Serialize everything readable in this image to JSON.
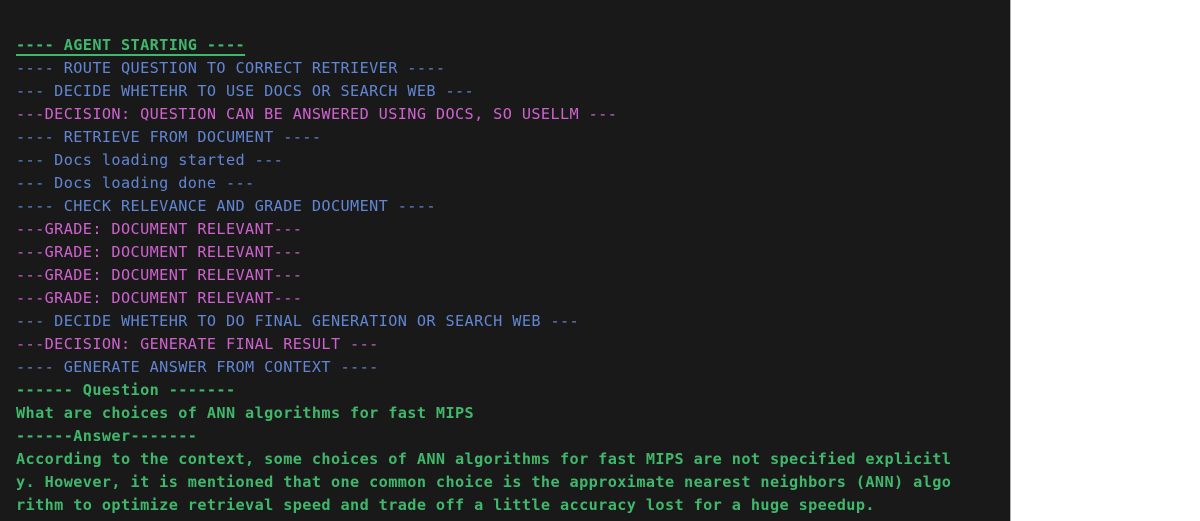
{
  "theme": {
    "terminal_background": "#191919",
    "page_background": "#ffffff",
    "divider": "#adadad",
    "green": "#3fb86b",
    "blue": "#6186d4",
    "magenta": "#d062d0"
  },
  "console": {
    "lines": [
      {
        "text": "---- AGENT STARTING ----",
        "color": "green",
        "bold": true,
        "underline": true
      },
      {
        "text": "---- ROUTE QUESTION TO CORRECT RETRIEVER ----",
        "color": "blue",
        "bold": false,
        "underline": false
      },
      {
        "text": "--- DECIDE WHETEHR TO USE DOCS OR SEARCH WEB ---",
        "color": "blue",
        "bold": false,
        "underline": false
      },
      {
        "text": "---DECISION: QUESTION CAN BE ANSWERED USING DOCS, SO USELLM ---",
        "color": "magenta",
        "bold": false,
        "underline": false
      },
      {
        "text": "---- RETRIEVE FROM DOCUMENT ----",
        "color": "blue",
        "bold": false,
        "underline": false
      },
      {
        "text": "--- Docs loading started ---",
        "color": "blue",
        "bold": false,
        "underline": false
      },
      {
        "text": "--- Docs loading done ---",
        "color": "blue",
        "bold": false,
        "underline": false
      },
      {
        "text": "---- CHECK RELEVANCE AND GRADE DOCUMENT ----",
        "color": "blue",
        "bold": false,
        "underline": false
      },
      {
        "text": "---GRADE: DOCUMENT RELEVANT---",
        "color": "magenta",
        "bold": false,
        "underline": false
      },
      {
        "text": "---GRADE: DOCUMENT RELEVANT---",
        "color": "magenta",
        "bold": false,
        "underline": false
      },
      {
        "text": "---GRADE: DOCUMENT RELEVANT---",
        "color": "magenta",
        "bold": false,
        "underline": false
      },
      {
        "text": "---GRADE: DOCUMENT RELEVANT---",
        "color": "magenta",
        "bold": false,
        "underline": false
      },
      {
        "text": "--- DECIDE WHETEHR TO DO FINAL GENERATION OR SEARCH WEB ---",
        "color": "blue",
        "bold": false,
        "underline": false
      },
      {
        "text": "---DECISION: GENERATE FINAL RESULT ---",
        "color": "magenta",
        "bold": false,
        "underline": false
      },
      {
        "text": "---- GENERATE ANSWER FROM CONTEXT ----",
        "color": "blue",
        "bold": false,
        "underline": false
      },
      {
        "text": "------ Question -------",
        "color": "green",
        "bold": true,
        "underline": false
      },
      {
        "text": "What are choices of ANN algorithms for fast MIPS",
        "color": "green",
        "bold": true,
        "underline": false
      },
      {
        "text": "------Answer-------",
        "color": "green",
        "bold": true,
        "underline": false
      },
      {
        "text": "According to the context, some choices of ANN algorithms for fast MIPS are not specified explicitl",
        "color": "green",
        "bold": true,
        "underline": false
      },
      {
        "text": "y. However, it is mentioned that one common choice is the approximate nearest neighbors (ANN) algo",
        "color": "green",
        "bold": true,
        "underline": false
      },
      {
        "text": "rithm to optimize retrieval speed and trade off a little accuracy lost for a huge speedup.",
        "color": "green",
        "bold": true,
        "underline": false
      }
    ]
  }
}
